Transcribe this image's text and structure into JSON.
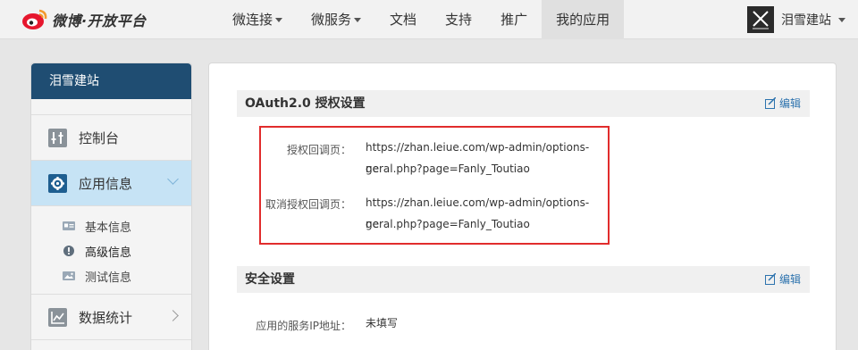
{
  "header": {
    "logo_text": "微博·开放平台",
    "nav": [
      {
        "label": "微连接",
        "has_caret": true
      },
      {
        "label": "微服务",
        "has_caret": true
      },
      {
        "label": "文档",
        "has_caret": false
      },
      {
        "label": "支持",
        "has_caret": false
      },
      {
        "label": "推广",
        "has_caret": false
      },
      {
        "label": "我的应用",
        "has_caret": false,
        "active": true
      }
    ],
    "user_name": "泪雪建站"
  },
  "sidebar": {
    "title": "泪雪建站",
    "items": [
      {
        "label": "控制台",
        "icon": "console-icon"
      },
      {
        "label": "应用信息",
        "icon": "gear-icon",
        "active": true
      }
    ],
    "sub_items": [
      {
        "label": "基本信息",
        "icon": "id-card-icon"
      },
      {
        "label": "高级信息",
        "icon": "info-icon"
      },
      {
        "label": "测试信息",
        "icon": "image-icon"
      }
    ],
    "stats": {
      "label": "数据统计",
      "icon": "chart-icon"
    }
  },
  "oauth": {
    "title": "OAuth2.0 授权设置",
    "edit_label": "编辑",
    "callback_label": "授权回调页：",
    "callback_line1": "https://zhan.leiue.com/wp-admin/options-ge",
    "callback_line2": "neral.php?page=Fanly_Toutiao",
    "cancel_label": "取消授权回调页：",
    "cancel_line1": "https://zhan.leiue.com/wp-admin/options-ge",
    "cancel_line2": "neral.php?page=Fanly_Toutiao"
  },
  "security": {
    "title": "安全设置",
    "edit_label": "编辑",
    "ip_label": "应用的服务IP地址：",
    "ip_value": "未填写"
  },
  "colors": {
    "sidebar_header": "#1f4d72",
    "active_item": "#c6e3f5",
    "highlight_border": "#e12c2c",
    "link": "#2d73ae"
  }
}
